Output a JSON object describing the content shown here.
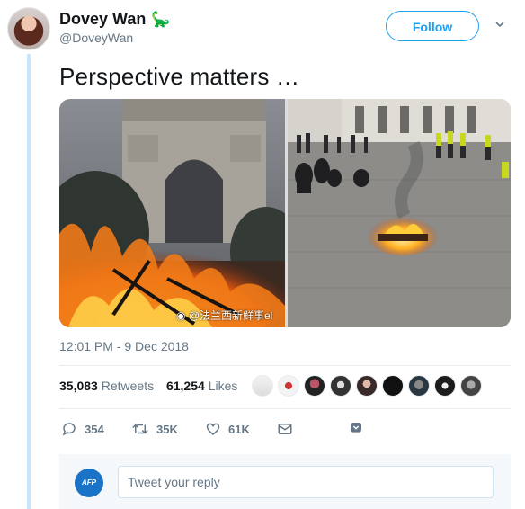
{
  "author": {
    "name": "Dovey Wan",
    "name_emoji": "🦕",
    "handle": "@DoveyWan"
  },
  "follow_label": "Follow",
  "tweet": {
    "text": "Perspective matters …",
    "watermark": "@法兰西新鲜事el",
    "timestamp": "12:01 PM - 9 Dec 2018"
  },
  "stats": {
    "retweets_count": "35,083",
    "retweets_label": "Retweets",
    "likes_count": "61,254",
    "likes_label": "Likes"
  },
  "actions": {
    "replies": "354",
    "retweets": "35K",
    "likes": "61K"
  },
  "reply": {
    "avatar_text": "AFP",
    "placeholder": "Tweet your reply"
  },
  "colors": {
    "accent": "#1da1f2",
    "muted": "#657786",
    "thread": "#c8e6fb"
  },
  "icons": [
    "reply-icon",
    "retweet-icon",
    "heart-icon",
    "envelope-icon",
    "chevron-down-icon"
  ]
}
